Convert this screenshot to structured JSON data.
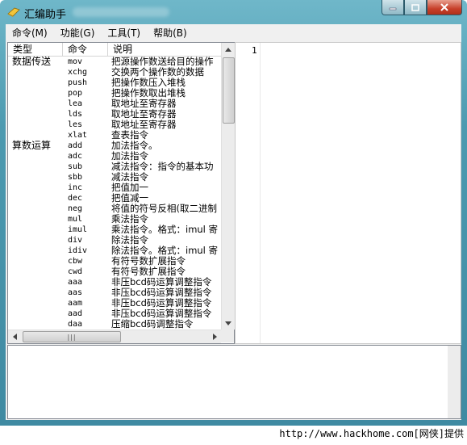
{
  "window": {
    "title": "汇编助手",
    "controls": [
      "minimize",
      "maximize",
      "close"
    ]
  },
  "menu": [
    {
      "label": "命令(M)"
    },
    {
      "label": "功能(G)"
    },
    {
      "label": "工具(T)"
    },
    {
      "label": "帮助(B)"
    }
  ],
  "list": {
    "headers": {
      "type": "类型",
      "command": "命令",
      "description": "说明"
    },
    "rows": [
      {
        "type": "数据传送",
        "cmd": "mov",
        "desc": "把源操作数送给目的操作"
      },
      {
        "type": "",
        "cmd": "xchg",
        "desc": "交换两个操作数的数据"
      },
      {
        "type": "",
        "cmd": "push",
        "desc": "把操作数压入堆栈"
      },
      {
        "type": "",
        "cmd": "pop",
        "desc": "把操作数取出堆栈"
      },
      {
        "type": "",
        "cmd": "lea",
        "desc": "取地址至寄存器"
      },
      {
        "type": "",
        "cmd": "lds",
        "desc": "取地址至寄存器"
      },
      {
        "type": "",
        "cmd": "les",
        "desc": "取地址至寄存器"
      },
      {
        "type": "",
        "cmd": "xlat",
        "desc": "查表指令"
      },
      {
        "type": "算数运算",
        "cmd": "add",
        "desc": "加法指令。"
      },
      {
        "type": "",
        "cmd": "adc",
        "desc": "加法指令"
      },
      {
        "type": "",
        "cmd": "sub",
        "desc": "减法指令：指令的基本功"
      },
      {
        "type": "",
        "cmd": "sbb",
        "desc": "减法指令"
      },
      {
        "type": "",
        "cmd": "inc",
        "desc": "把值加一"
      },
      {
        "type": "",
        "cmd": "dec",
        "desc": "把值减一"
      },
      {
        "type": "",
        "cmd": "neg",
        "desc": "将值的符号反相(取二进制"
      },
      {
        "type": "",
        "cmd": "mul",
        "desc": "乘法指令"
      },
      {
        "type": "",
        "cmd": "imul",
        "desc": "乘法指令。格式：imul 寄"
      },
      {
        "type": "",
        "cmd": "div",
        "desc": "除法指令"
      },
      {
        "type": "",
        "cmd": "idiv",
        "desc": "除法指令。格式：imul 寄"
      },
      {
        "type": "",
        "cmd": "cbw",
        "desc": "有符号数扩展指令"
      },
      {
        "type": "",
        "cmd": "cwd",
        "desc": "有符号数扩展指令"
      },
      {
        "type": "",
        "cmd": "aaa",
        "desc": "非压bcd码运算调整指令"
      },
      {
        "type": "",
        "cmd": "aas",
        "desc": "非压bcd码运算调整指令"
      },
      {
        "type": "",
        "cmd": "aam",
        "desc": "非压bcd码运算调整指令"
      },
      {
        "type": "",
        "cmd": "aad",
        "desc": "非压bcd码运算调整指令"
      },
      {
        "type": "",
        "cmd": "daa",
        "desc": "压缩bcd码调整指令"
      }
    ]
  },
  "editor": {
    "line_number": "1"
  },
  "watermark": "http://www.hackhome.com[网侠]提供"
}
